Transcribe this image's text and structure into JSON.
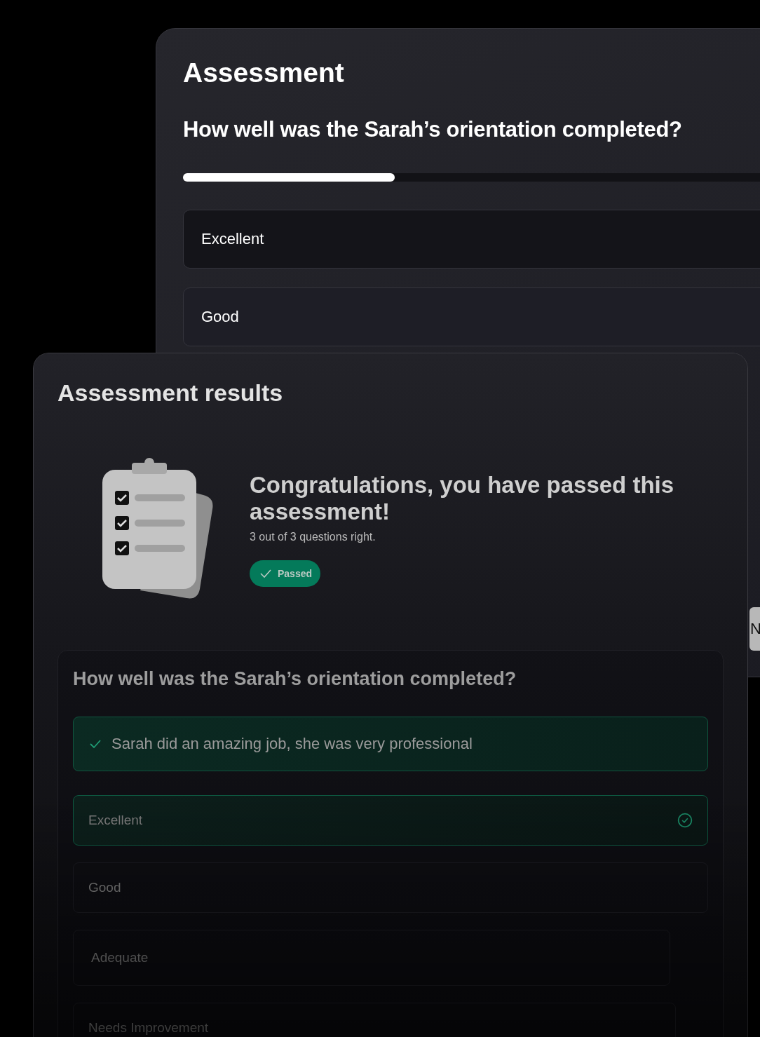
{
  "back_card": {
    "title": "Assessment",
    "question": "How well was the Sarah’s orientation completed?",
    "progress": {
      "level": 0.33
    },
    "options": [
      {
        "label": "Excellent",
        "selected": true
      },
      {
        "label": "Good",
        "selected": false
      }
    ],
    "next_button": {
      "label": "N"
    }
  },
  "results_card": {
    "title": "Assessment results",
    "heading": "Congratulations, you have passed this assessment!",
    "score": "3 out of 3 questions right.",
    "status": {
      "label": "Passed",
      "kind": "passed"
    },
    "questions": [
      {
        "question": "How well was the Sarah’s orientation completed?",
        "answer": "Sarah did an amazing job, she was very professional",
        "correct": true,
        "options": [
          {
            "label": "Excellent",
            "selected": true
          },
          {
            "label": "Good",
            "selected": false
          },
          {
            "label": "Adequate",
            "selected": false
          },
          {
            "label": "Needs Improvement",
            "selected": false
          }
        ]
      }
    ]
  }
}
